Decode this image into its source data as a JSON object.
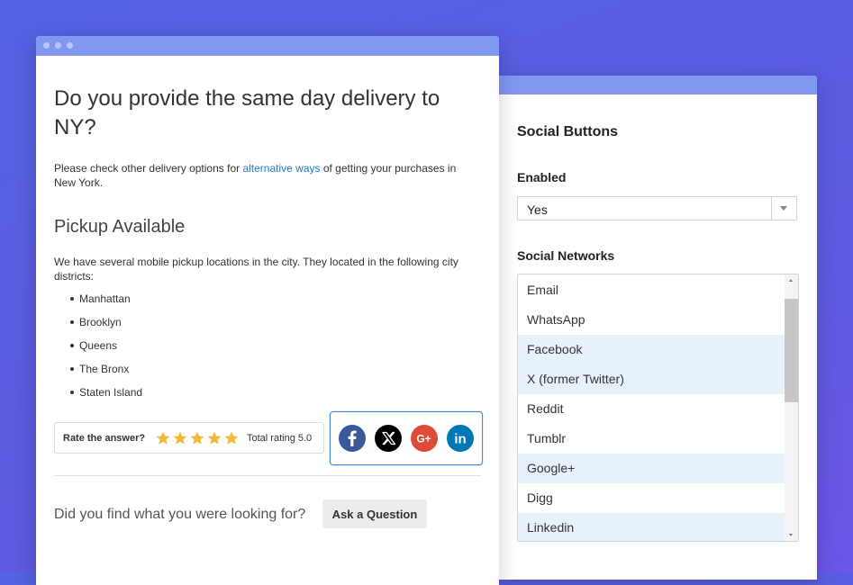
{
  "faq": {
    "question": "Do you provide the same day delivery to NY?",
    "intro_before": "Please check other delivery options for ",
    "intro_link": "alternative ways",
    "intro_after": " of getting your purchases in New York.",
    "pickup_heading": "Pickup Available",
    "pickup_text": "We have several mobile pickup locations in the city. They located in the following city districts:",
    "districts": [
      "Manhattan",
      "Brooklyn",
      "Queens",
      "The Bronx",
      "Staten Island"
    ],
    "rate_label": "Rate the answer?",
    "rating_stars": 5,
    "rating_text": "Total rating 5.0",
    "social_icons": [
      {
        "name": "facebook-icon",
        "glyph": "f",
        "color": "#3b5998"
      },
      {
        "name": "x-icon",
        "glyph": "X",
        "color": "#000000"
      },
      {
        "name": "google-plus-icon",
        "glyph": "G+",
        "color": "#dd4b39"
      },
      {
        "name": "linkedin-icon",
        "glyph": "in",
        "color": "#0077b5"
      }
    ],
    "found_text": "Did you find what you were looking for?",
    "ask_button": "Ask a Question"
  },
  "settings": {
    "title": "Social Buttons",
    "enabled_label": "Enabled",
    "enabled_value": "Yes",
    "networks_label": "Social Networks",
    "networks": [
      {
        "label": "Email",
        "selected": false
      },
      {
        "label": "WhatsApp",
        "selected": false
      },
      {
        "label": "Facebook",
        "selected": true
      },
      {
        "label": "X (former Twitter)",
        "selected": true
      },
      {
        "label": "Reddit",
        "selected": false
      },
      {
        "label": "Tumblr",
        "selected": false
      },
      {
        "label": "Google+",
        "selected": true
      },
      {
        "label": "Digg",
        "selected": false
      },
      {
        "label": "Linkedin",
        "selected": true
      }
    ]
  },
  "colors": {
    "background": "#5462e3",
    "window_bar": "#8098f0",
    "link": "#1e7bd0",
    "star": "#f2b83a",
    "selected_row": "#e6f1fc",
    "social_border": "#3b87d4"
  }
}
